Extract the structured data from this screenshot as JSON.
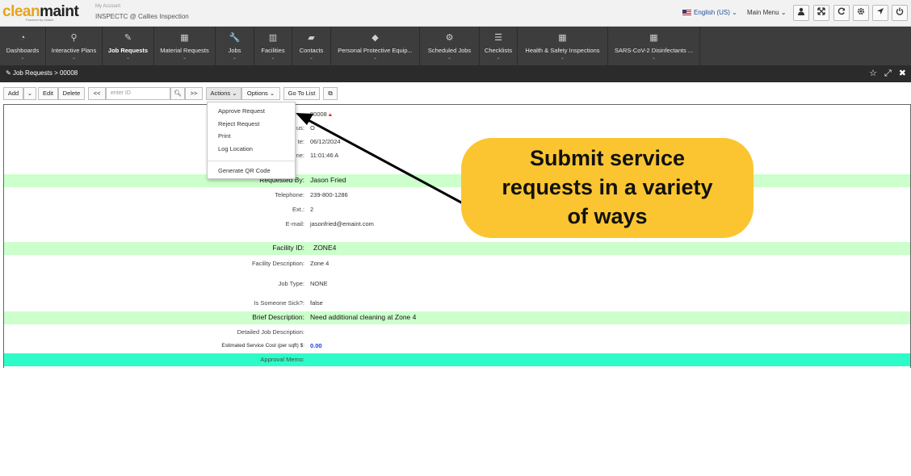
{
  "header": {
    "logo_part1": "clean",
    "logo_part2": "maint",
    "logo_sub": "Powered by eMaint",
    "account_label": "My Account",
    "inspection_name": "INSPECTC @ Callies Inspection",
    "language": "English (US)",
    "main_menu": "Main Menu",
    "chevron": "⌄",
    "icons": [
      "user-icon",
      "expand-icon",
      "refresh-icon",
      "gear-icon",
      "location-arrow-icon",
      "power-icon"
    ]
  },
  "nav": {
    "items": [
      {
        "label": "Dashboards",
        "icon": "dashboard-icon",
        "caret": "⌄"
      },
      {
        "label": "Interactive Plans",
        "icon": "map-marker-icon",
        "caret": "⌄"
      },
      {
        "label": "Job Requests",
        "icon": "pencil-icon",
        "caret": "⌄"
      },
      {
        "label": "Material Requests",
        "icon": "grid-icon",
        "caret": "⌄"
      },
      {
        "label": "Jobs",
        "icon": "wrench-icon",
        "caret": "⌄"
      },
      {
        "label": "Facilities",
        "icon": "barcode-icon",
        "caret": "⌄"
      },
      {
        "label": "Contacts",
        "icon": "book-icon",
        "caret": "⌄"
      },
      {
        "label": "Personal Protective Equip...",
        "icon": "tags-icon",
        "caret": "⌄"
      },
      {
        "label": "Scheduled Jobs",
        "icon": "cogs-icon",
        "caret": "⌄"
      },
      {
        "label": "Checklists",
        "icon": "list-icon",
        "caret": "⌄"
      },
      {
        "label": "Health & Safety Inspections",
        "icon": "grid-icon",
        "caret": "⌄"
      },
      {
        "label": "SARS-CoV-2 Disinfectants ...",
        "icon": "grid-icon",
        "caret": "⌄"
      }
    ]
  },
  "breadcrumb": {
    "text": "Job Requests > 00008"
  },
  "toolbar": {
    "add": "Add",
    "add_caret": "⌄",
    "edit": "Edit",
    "delete": "Delete",
    "prev": "<<",
    "id_placeholder": "enter ID",
    "next": ">>",
    "actions": "Actions ⌄",
    "options": "Options ⌄",
    "go_to_list": "Go To List"
  },
  "actions_menu": {
    "items": [
      "Approve Request",
      "Reject Request",
      "Print",
      "Log Location",
      "Generate QR Code"
    ]
  },
  "form": {
    "partial_labels": [
      "us:",
      "te:",
      "ne:"
    ],
    "request_number": "00008",
    "status": "O",
    "date": "06/12/2024",
    "time": "11:01:46 A",
    "rows": [
      {
        "label": "Requested By:",
        "value": "Jason Fried"
      },
      {
        "label": "Telephone:",
        "value": "239-800-1286"
      },
      {
        "label": "Ext.:",
        "value": "2"
      },
      {
        "label": "E-mail:",
        "value": "jasonfried@emaint.com"
      },
      {
        "label": "Facility ID:",
        "value": "ZONE4"
      },
      {
        "label": "Facility Description:",
        "value": "Zone 4"
      },
      {
        "label": "Job Type:",
        "value": "NONE"
      },
      {
        "label": "Is Someone Sick?:",
        "value": "false"
      },
      {
        "label": "Brief Description:",
        "value": "Need additional cleaning at Zone 4"
      },
      {
        "label": "Detailed Job Description:",
        "value": ""
      },
      {
        "label": "Estimated Service Cost (per sqft) $:",
        "value": "0.00"
      },
      {
        "label": "Approval Memo:",
        "value": ""
      }
    ]
  },
  "callout": {
    "line1": "Submit service",
    "line2": "requests in a variety",
    "line3": "of ways"
  },
  "colors": {
    "band_green": "#ccffcc",
    "band_teal": "#2efcc8",
    "callout_yellow": "#fbc531",
    "nav_dark": "#3d3d3d"
  }
}
